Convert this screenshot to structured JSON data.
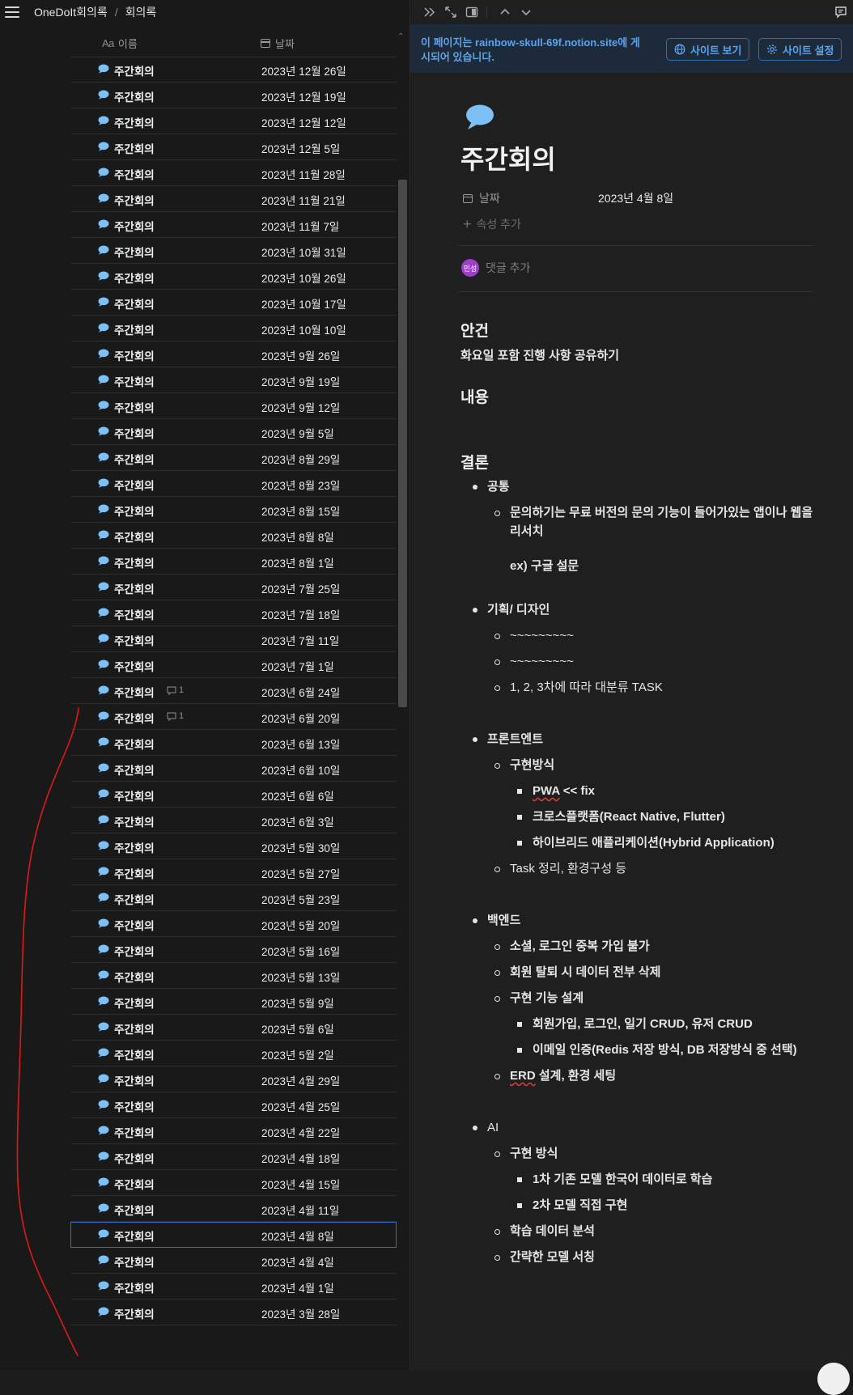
{
  "left": {
    "breadcrumb": [
      "OneDoIt회의록",
      "회의록"
    ],
    "columns": {
      "name": "이름",
      "name_icon": "Aa",
      "date": "날짜"
    },
    "rows": [
      {
        "title": "주간회의",
        "date": "2023년 12월 26일"
      },
      {
        "title": "주간회의",
        "date": "2023년 12월 19일"
      },
      {
        "title": "주간회의",
        "date": "2023년 12월 12일"
      },
      {
        "title": "주간회의",
        "date": "2023년 12월 5일"
      },
      {
        "title": "주간회의",
        "date": "2023년 11월 28일"
      },
      {
        "title": "주간회의",
        "date": "2023년 11월 21일"
      },
      {
        "title": "주간회의",
        "date": "2023년 11월 7일"
      },
      {
        "title": "주간회의",
        "date": "2023년 10월 31일"
      },
      {
        "title": "주간회의",
        "date": "2023년 10월 26일"
      },
      {
        "title": "주간회의",
        "date": "2023년 10월 17일"
      },
      {
        "title": "주간회의",
        "date": "2023년 10월 10일"
      },
      {
        "title": "주간회의",
        "date": "2023년 9월 26일"
      },
      {
        "title": "주간회의",
        "date": "2023년 9월 19일"
      },
      {
        "title": "주간회의",
        "date": "2023년 9월 12일"
      },
      {
        "title": "주간회의",
        "date": "2023년 9월 5일"
      },
      {
        "title": "주간회의",
        "date": "2023년 8월 29일"
      },
      {
        "title": "주간회의",
        "date": "2023년 8월 23일"
      },
      {
        "title": "주간회의",
        "date": "2023년 8월 15일"
      },
      {
        "title": "주간회의",
        "date": "2023년 8월 8일"
      },
      {
        "title": "주간회의",
        "date": "2023년 8월 1일"
      },
      {
        "title": "주간회의",
        "date": "2023년 7월 25일"
      },
      {
        "title": "주간회의",
        "date": "2023년 7월 18일"
      },
      {
        "title": "주간회의",
        "date": "2023년 7월 11일"
      },
      {
        "title": "주간회의",
        "date": "2023년 7월 1일"
      },
      {
        "title": "주간회의",
        "date": "2023년 6월 24일",
        "comments": "1"
      },
      {
        "title": "주간회의",
        "date": "2023년 6월 20일",
        "comments": "1"
      },
      {
        "title": "주간회의",
        "date": "2023년 6월 13일"
      },
      {
        "title": "주간회의",
        "date": "2023년 6월 10일"
      },
      {
        "title": "주간회의",
        "date": "2023년 6월 6일"
      },
      {
        "title": "주간회의",
        "date": "2023년 6월 3일"
      },
      {
        "title": "주간회의",
        "date": "2023년 5월 30일"
      },
      {
        "title": "주간회의",
        "date": "2023년 5월 27일"
      },
      {
        "title": "주간회의",
        "date": "2023년 5월 23일"
      },
      {
        "title": "주간회의",
        "date": "2023년 5월 20일"
      },
      {
        "title": "주간회의",
        "date": "2023년 5월 16일"
      },
      {
        "title": "주간회의",
        "date": "2023년 5월 13일"
      },
      {
        "title": "주간회의",
        "date": "2023년 5월 9일"
      },
      {
        "title": "주간회의",
        "date": "2023년 5월 6일"
      },
      {
        "title": "주간회의",
        "date": "2023년 5월 2일"
      },
      {
        "title": "주간회의",
        "date": "2023년 4월 29일"
      },
      {
        "title": "주간회의",
        "date": "2023년 4월 25일"
      },
      {
        "title": "주간회의",
        "date": "2023년 4월 22일"
      },
      {
        "title": "주간회의",
        "date": "2023년 4월 18일"
      },
      {
        "title": "주간회의",
        "date": "2023년 4월 15일"
      },
      {
        "title": "주간회의",
        "date": "2023년 4월 11일"
      },
      {
        "title": "주간회의",
        "date": "2023년 4월 8일",
        "selected": true
      },
      {
        "title": "주간회의",
        "date": "2023년 4월 4일"
      },
      {
        "title": "주간회의",
        "date": "2023년 4월 1일"
      },
      {
        "title": "주간회의",
        "date": "2023년 3월 28일"
      }
    ]
  },
  "banner": {
    "text": "이 페이지는 rainbow-skull-69f.notion.site에 게시되어 있습니다.",
    "view_site": "사이트 보기",
    "site_settings": "사이트 설정"
  },
  "page": {
    "title": "주간회의",
    "prop_name": "날짜",
    "prop_value": "2023년 4월 8일",
    "add_property": "속성 추가",
    "avatar_initials": "민성",
    "add_comment": "댓글 추가",
    "agenda_heading": "안건",
    "agenda_text": "화요일 포함 진행 사항 공유하기",
    "content_heading": "내용",
    "conclusion_heading": "결론",
    "common": {
      "label": "공통",
      "item1": "문의하기는 무료 버전의 문의 기능이 들어가있는 앱이나 웹을 리서치",
      "item1_note": "ex) 구글 설문"
    },
    "planning": {
      "label": "기획/ 디자인",
      "item1": "~~~~~~~~~",
      "item2": "~~~~~~~~~",
      "item3": "1, 2, 3차에 따라 대분류 TASK"
    },
    "frontend": {
      "label": "프론트엔트",
      "sub1": "구현방식",
      "sub1_a_word": "PWA",
      "sub1_a_rest": " << fix",
      "sub1_b": "크로스플랫폼(React Native, Flutter)",
      "sub1_c": "하이브리드 애플리케이션(Hybrid Application)",
      "sub2": "Task 정리, 환경구성 등"
    },
    "backend": {
      "label": "백엔드",
      "sub1": "소셜, 로그인 중복 가입 불가",
      "sub2": "회원 탈퇴 시 데이터 전부 삭제",
      "sub3": "구현 기능 설계",
      "sub3_a": "회원가입, 로그인, 일기 CRUD, 유저 CRUD",
      "sub3_b": "이메일 인증(Redis 저장 방식, DB 저장방식 중 선택)",
      "sub4_word": "ERD",
      "sub4_rest": " 설계, 환경 세팅"
    },
    "ai": {
      "label": "AI",
      "sub1": "구현 방식",
      "sub1_a": "1차 기존 모델 한국어 데이터로 학습",
      "sub1_b": "2차 모델 직접 구현",
      "sub2": "학습 데이터 분석",
      "sub3": "간략한 모델 서칭"
    }
  },
  "colors": {
    "accent_blue": "#5aa3ee",
    "bubble_blue": "#7cc0f5",
    "annotation_red": "#e01818",
    "avatar_purple": "#9b3fc7"
  }
}
